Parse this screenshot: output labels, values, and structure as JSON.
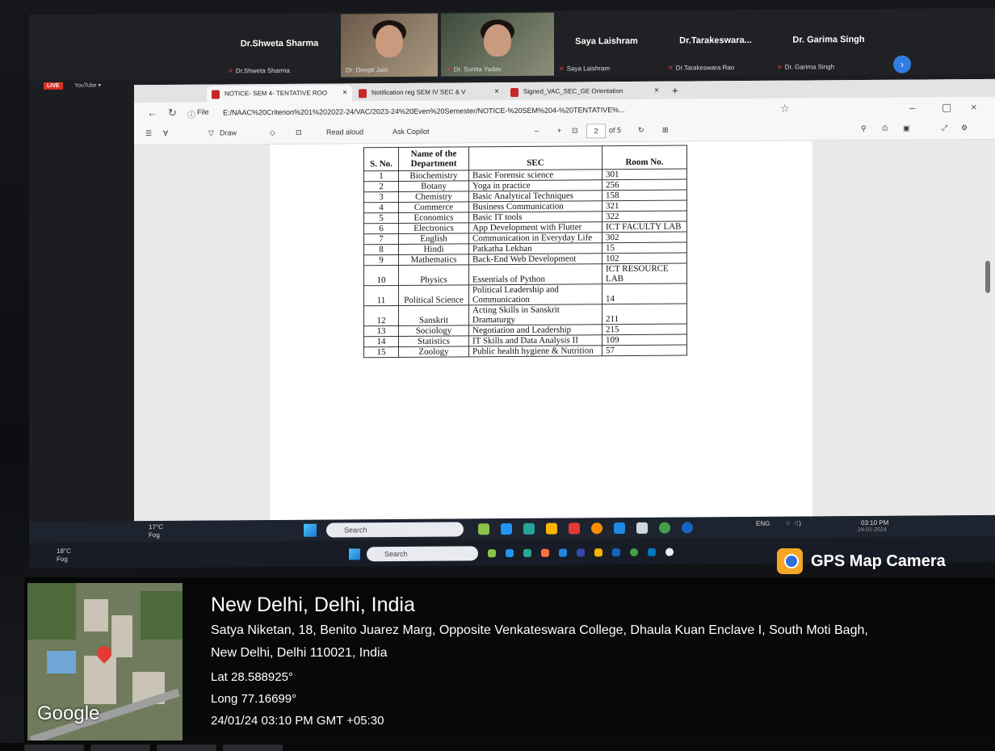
{
  "meeting": {
    "participants": [
      {
        "name": "Dr.Shweta Sharma",
        "label": "Dr.Shweta Sharma"
      },
      {
        "name": "",
        "label": "Dr. Deepti Jain"
      },
      {
        "name": "",
        "label": "Dr. Sunita Yadav"
      },
      {
        "name": "Saya Laishram",
        "label": "Saya Laishram"
      },
      {
        "name": "Dr.Tarakeswara...",
        "label": "Dr.Tarakeswara Rao"
      },
      {
        "name": "Dr. Garima Singh",
        "label": "Dr. Garima Singh"
      }
    ],
    "live_badge": "LIVE",
    "youtube_label": "YouTube ▾"
  },
  "browser": {
    "tabs": [
      {
        "label": "NOTICE- SEM 4- TENTATIVE ROO"
      },
      {
        "label": "Notification reg SEM IV SEC & V"
      },
      {
        "label": "Signed_VAC_SEC_GE Orientation"
      }
    ],
    "new_tab": "+",
    "file_label": "File",
    "url": "E:/NAAC%20Criterion%201%202022-24/VAC/2023-24%20Even%20Semester/NOTICE-%20SEM%204-%20TENTATIVE%...",
    "pdf_toolbar": {
      "draw": "Draw",
      "read_aloud": "Read aloud",
      "ask_copilot": "Ask Copilot",
      "page_current": "2",
      "page_total": "of 5"
    }
  },
  "table": {
    "headers": [
      "S. No.",
      "Name of the Department",
      "SEC",
      "Room No."
    ],
    "rows": [
      [
        "1",
        "Biochemistry",
        "Basic Forensic science",
        "301"
      ],
      [
        "2",
        "Botany",
        "Yoga in practice",
        "256"
      ],
      [
        "3",
        "Chemistry",
        "Basic Analytical Techniques",
        "158"
      ],
      [
        "4",
        "Commerce",
        "Business Communication",
        "321"
      ],
      [
        "5",
        "Economics",
        "Basic IT tools",
        "322"
      ],
      [
        "6",
        "Electronics",
        "App Development with Flutter",
        "ICT FACULTY LAB"
      ],
      [
        "7",
        "English",
        "Communication in Everyday Life",
        "302"
      ],
      [
        "8",
        "Hindi",
        "Patkatha Lekhan",
        "15"
      ],
      [
        "9",
        "Mathematics",
        "Back-End Web Development",
        "102"
      ],
      [
        "10",
        "Physics",
        "Essentials of Python",
        "ICT RESOURCE LAB"
      ],
      [
        "11",
        "Political Science",
        "Political Leadership and Communication",
        "14"
      ],
      [
        "12",
        "Sanskrit",
        "Acting Skills in Sanskrit Dramaturgy",
        "211"
      ],
      [
        "13",
        "Sociology",
        "Negotiation and Leadership",
        "215"
      ],
      [
        "14",
        "Statistics",
        "IT Skills and Data Analysis II",
        "109"
      ],
      [
        "15",
        "Zoology",
        "Public health hygiene & Nutrition",
        "57"
      ]
    ]
  },
  "taskbar": {
    "weather_temp": "17°C",
    "weather_desc": "Fog",
    "search_label": "Search",
    "lang": "ENG",
    "time": "03:10 PM",
    "date": "24-01-2024",
    "weather2_temp": "18°C",
    "weather2_desc": "Fog"
  },
  "gps": {
    "app_name": "GPS Map Camera",
    "map_brand": "Google",
    "city": "New Delhi, Delhi, India",
    "address_line1": "Satya Niketan, 18, Benito Juarez Marg, Opposite Venkateswara College, Dhaula Kuan Enclave I, South Moti Bagh,",
    "address_line2": "New Delhi, Delhi 110021, India",
    "lat": "Lat 28.588925°",
    "long": "Long 77.16699°",
    "timestamp": "24/01/24 03:10 PM GMT +05:30"
  }
}
